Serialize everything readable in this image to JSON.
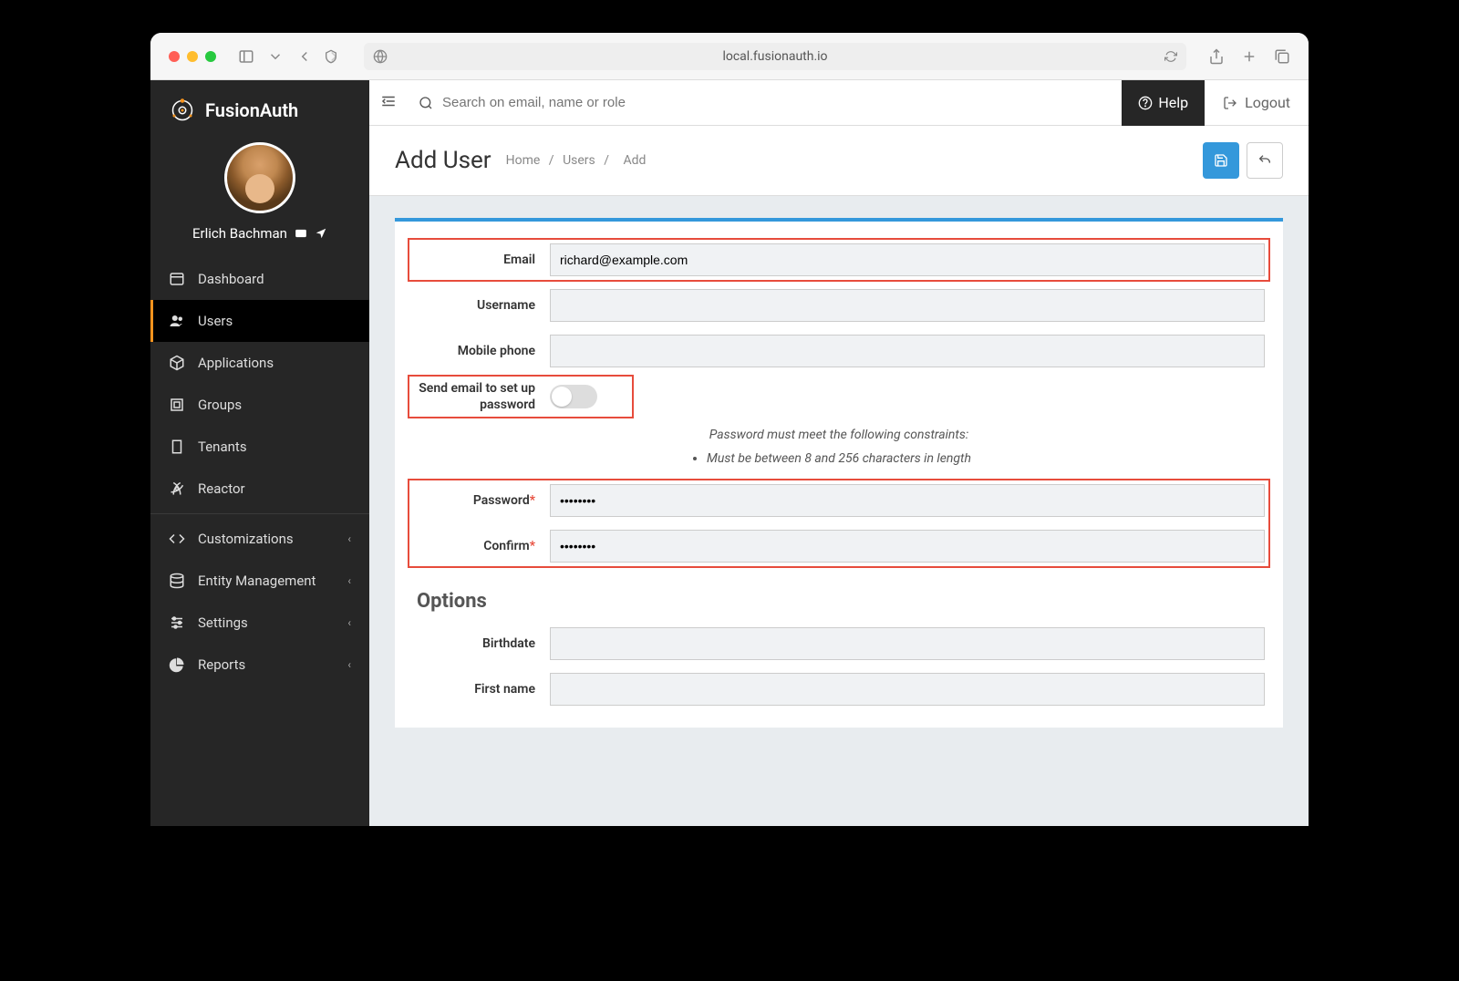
{
  "browser": {
    "url": "local.fusionauth.io"
  },
  "brand": "FusionAuth",
  "profile": {
    "name": "Erlich Bachman"
  },
  "sidebar": {
    "items": [
      {
        "label": "Dashboard"
      },
      {
        "label": "Users"
      },
      {
        "label": "Applications"
      },
      {
        "label": "Groups"
      },
      {
        "label": "Tenants"
      },
      {
        "label": "Reactor"
      },
      {
        "label": "Customizations"
      },
      {
        "label": "Entity Management"
      },
      {
        "label": "Settings"
      },
      {
        "label": "Reports"
      }
    ]
  },
  "topbar": {
    "search_placeholder": "Search on email, name or role",
    "help": "Help",
    "logout": "Logout"
  },
  "page": {
    "title": "Add User",
    "breadcrumb": {
      "home": "Home",
      "users": "Users",
      "add": "Add"
    }
  },
  "form": {
    "email_label": "Email",
    "email_value": "richard@example.com",
    "username_label": "Username",
    "username_value": "",
    "mobile_label": "Mobile phone",
    "mobile_value": "",
    "send_email_label": "Send email to set up password",
    "hint": "Password must meet the following constraints:",
    "hint_rule": "Must be between 8 and 256 characters in length",
    "password_label": "Password",
    "password_value": "••••••••",
    "confirm_label": "Confirm",
    "confirm_value": "••••••••",
    "options_title": "Options",
    "birthdate_label": "Birthdate",
    "birthdate_value": "",
    "firstname_label": "First name",
    "firstname_value": ""
  }
}
